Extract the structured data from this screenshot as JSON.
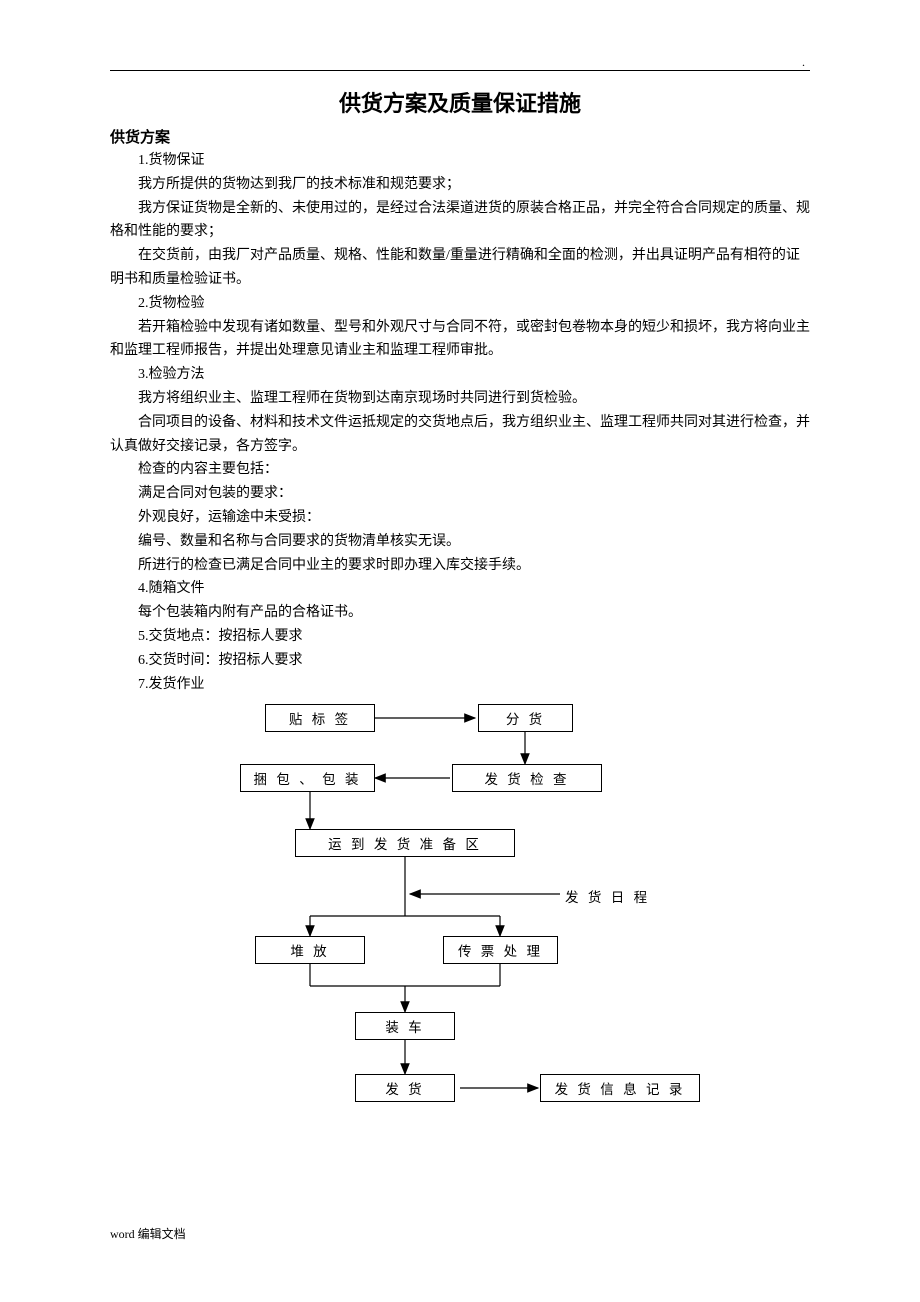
{
  "dot": ".",
  "title": "供货方案及质量保证措施",
  "heading": "供货方案",
  "paragraphs": [
    "1.货物保证",
    "我方所提供的货物达到我厂的技术标准和规范要求；",
    "我方保证货物是全新的、未使用过的，是经过合法渠道进货的原装合格正品，并完全符合合同规定的质量、规格和性能的要求；",
    "在交货前，由我厂对产品质量、规格、性能和数量/重量进行精确和全面的检测，并出具证明产品有相符的证明书和质量检验证书。",
    "2.货物检验",
    "若开箱检验中发现有诸如数量、型号和外观尺寸与合同不符，或密封包卷物本身的短少和损坏，我方将向业主和监理工程师报告，并提出处理意见请业主和监理工程师审批。",
    "3.检验方法",
    "我方将组织业主、监理工程师在货物到达南京现场时共同进行到货检验。",
    "合同项目的设备、材料和技术文件运抵规定的交货地点后，我方组织业主、监理工程师共同对其进行检查，并认真做好交接记录，各方签字。",
    "检查的内容主要包括：",
    "满足合同对包装的要求：",
    "外观良好，运输途中未受损：",
    "编号、数量和名称与合同要求的货物清单核实无误。",
    "所进行的检查已满足合同中业主的要求时即办理入库交接手续。",
    "4.随箱文件",
    "每个包装箱内附有产品的合格证书。",
    "5.交货地点：按招标人要求",
    "6.交货时间：按招标人要求",
    "7.发货作业"
  ],
  "flow": {
    "b1": "贴 标 签",
    "b2": "分 货",
    "b3": "捆 包 、 包 装",
    "b4": "发 货 检 查",
    "b5": "运 到 发 货 准 备 区",
    "b6": "堆    放",
    "b7": "传 票 处 理",
    "b8": "装 车",
    "b9": "发 货",
    "b10": "发 货 信 息 记 录",
    "side": "发 货 日 程"
  },
  "footer": "word 编辑文档"
}
